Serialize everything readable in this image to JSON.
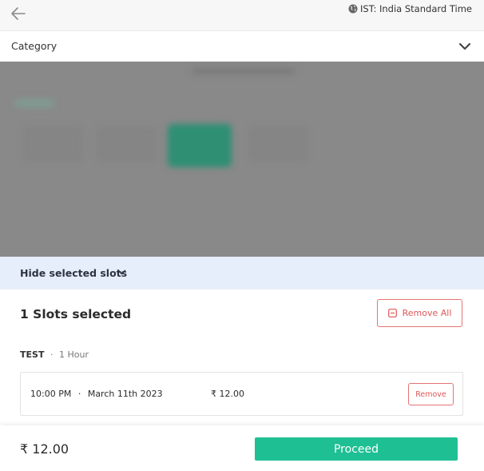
{
  "header": {
    "timezone_label": "IST: India Standard Time"
  },
  "category": {
    "label": "Category"
  },
  "selection": {
    "hide_label": "Hide selected slots",
    "count_label": "1 Slots selected",
    "remove_all_label": "Remove All",
    "service_name": "TEST",
    "service_separator": "·",
    "service_duration": "1 Hour",
    "slots": [
      {
        "time": "10:00 PM",
        "separator": "·",
        "date": "March 11th 2023",
        "price": "₹ 12.00",
        "remove_label": "Remove"
      }
    ]
  },
  "footer": {
    "total": "₹ 12.00",
    "proceed_label": "Proceed"
  },
  "colors": {
    "accent": "#1fbf94",
    "danger": "#e05656",
    "highlight_bar": "#e6eefb",
    "overlay": "#898989"
  }
}
